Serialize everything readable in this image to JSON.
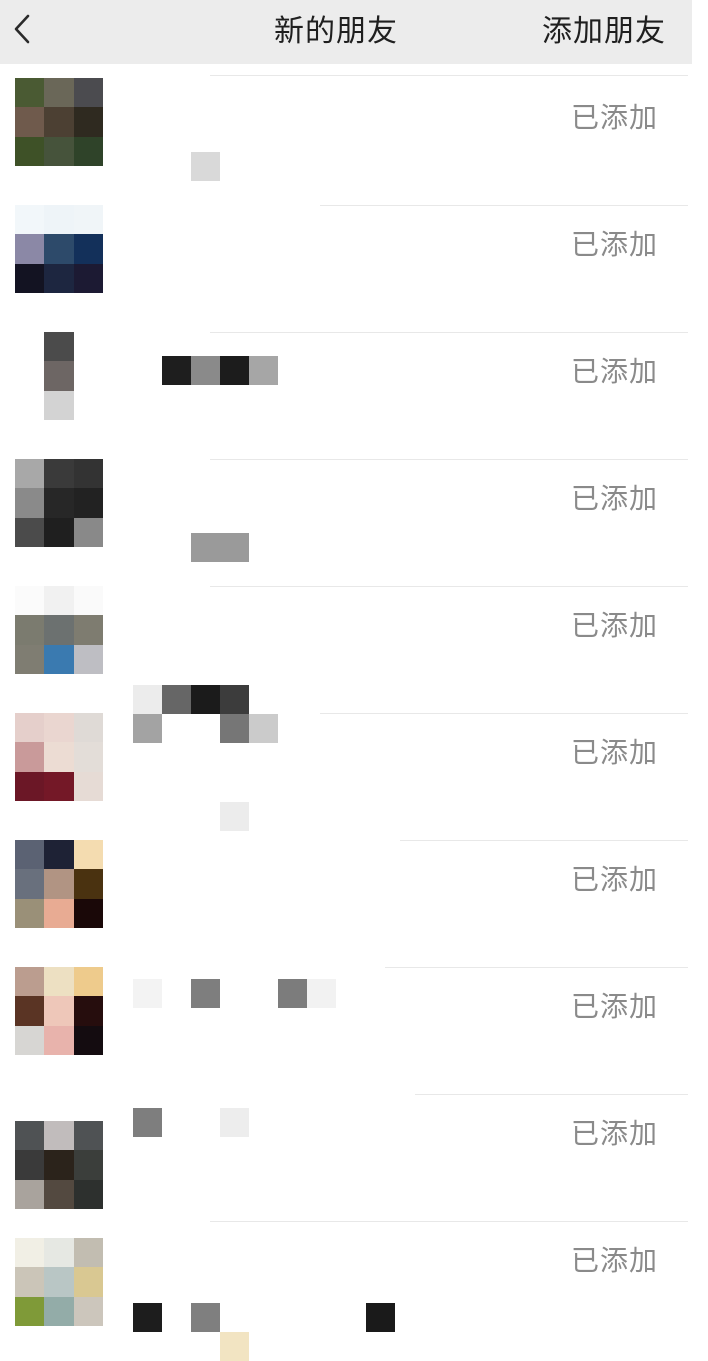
{
  "header": {
    "back_icon": "chevron-left-icon",
    "title": "新的朋友",
    "add_friend_label": "添加朋友"
  },
  "requests": [
    {
      "status": "已添加"
    },
    {
      "status": "已添加"
    },
    {
      "status": "已添加"
    },
    {
      "status": "已添加"
    },
    {
      "status": "已添加"
    },
    {
      "status": "已添加"
    },
    {
      "status": "已添加"
    },
    {
      "status": "已添加"
    },
    {
      "status": "已添加"
    },
    {
      "status": "已添加"
    }
  ]
}
